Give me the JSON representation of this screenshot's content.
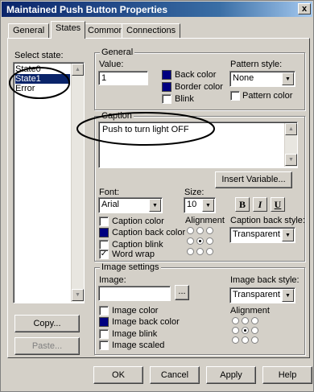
{
  "window": {
    "title": "Maintained Push Button Properties",
    "close_label": "x"
  },
  "tabs": [
    {
      "label": "General"
    },
    {
      "label": "States"
    },
    {
      "label": "Common"
    },
    {
      "label": "Connections"
    }
  ],
  "states": {
    "label": "Select state:",
    "items": [
      "State0",
      "State1",
      "Error"
    ],
    "selected": "State1",
    "copy_label": "Copy...",
    "paste_label": "Paste..."
  },
  "general": {
    "group_label": "General",
    "value_label": "Value:",
    "value": "1",
    "back_color_label": "Back color",
    "border_color_label": "Border color",
    "blink_label": "Blink",
    "pattern_style_label": "Pattern style:",
    "pattern_style": "None",
    "pattern_color_label": "Pattern color"
  },
  "caption": {
    "group_label": "Caption",
    "text": "Push to turn light OFF",
    "insert_variable_label": "Insert Variable...",
    "font_label": "Font:",
    "font_value": "Arial",
    "size_label": "Size:",
    "size_value": "10",
    "bold_label": "B",
    "italic_label": "I",
    "underline_label": "U",
    "caption_color_label": "Caption color",
    "caption_back_color_label": "Caption back color",
    "caption_blink_label": "Caption blink",
    "word_wrap_label": "Word wrap",
    "word_wrap_check": "✓",
    "alignment_label": "Alignment",
    "caption_back_style_label": "Caption back style:",
    "caption_back_style": "Transparent"
  },
  "image": {
    "group_label": "Image settings",
    "image_label": "Image:",
    "browse_label": "...",
    "image_back_style_label": "Image back style:",
    "image_back_style": "Transparent",
    "image_color_label": "Image color",
    "image_back_color_label": "Image back color",
    "image_blink_label": "Image blink",
    "image_scaled_label": "Image scaled",
    "alignment_label": "Alignment"
  },
  "buttons": {
    "ok": "OK",
    "cancel": "Cancel",
    "apply": "Apply",
    "help": "Help"
  },
  "colors": {
    "title_bar": "#0a246a",
    "swatch": "#000080",
    "dialog": "#d4d0c8"
  }
}
